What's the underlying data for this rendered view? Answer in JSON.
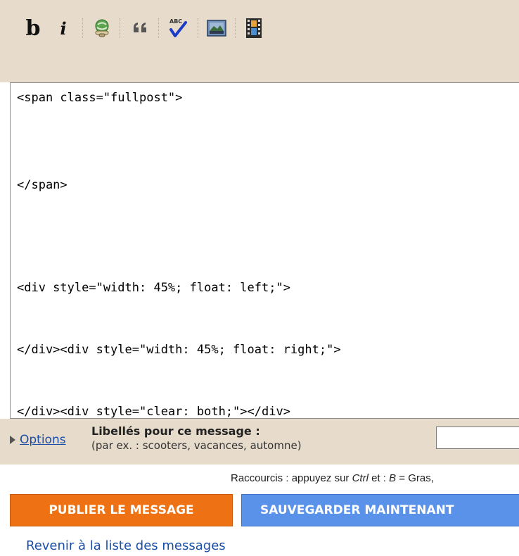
{
  "toolbar": {
    "bold_label": "b",
    "italic_label": "i",
    "icons": [
      "link-icon",
      "blockquote-icon",
      "spellcheck-icon",
      "image-icon",
      "video-icon"
    ]
  },
  "editor": {
    "lines": [
      "<span class=\"fullpost\">",
      "</span>",
      "<div style=\"width: 45%; float: left;\">",
      "</div><div style=\"width: 45%; float: right;\">",
      "</div><div style=\"clear: both;\"></div>"
    ]
  },
  "options": {
    "toggle_label": "Options",
    "labels_title": "Libellés pour ce message :",
    "labels_hint": "(par ex. : scooters, vacances, automne)",
    "labels_value": ""
  },
  "shortcuts": {
    "prefix": "Raccourcis : appuyez sur ",
    "key": "Ctrl",
    "middle": " et : ",
    "b_key": "B",
    "suffix": " = Gras,"
  },
  "actions": {
    "publish_label": "PUBLIER LE MESSAGE",
    "save_label": "SAUVEGARDER MAINTENANT",
    "back_label": "Revenir à la liste des messages"
  },
  "colors": {
    "toolbar_bg": "#e7dccc",
    "publish_bg": "#ee7214",
    "save_bg": "#5a92ea",
    "link": "#1a4ea6"
  }
}
